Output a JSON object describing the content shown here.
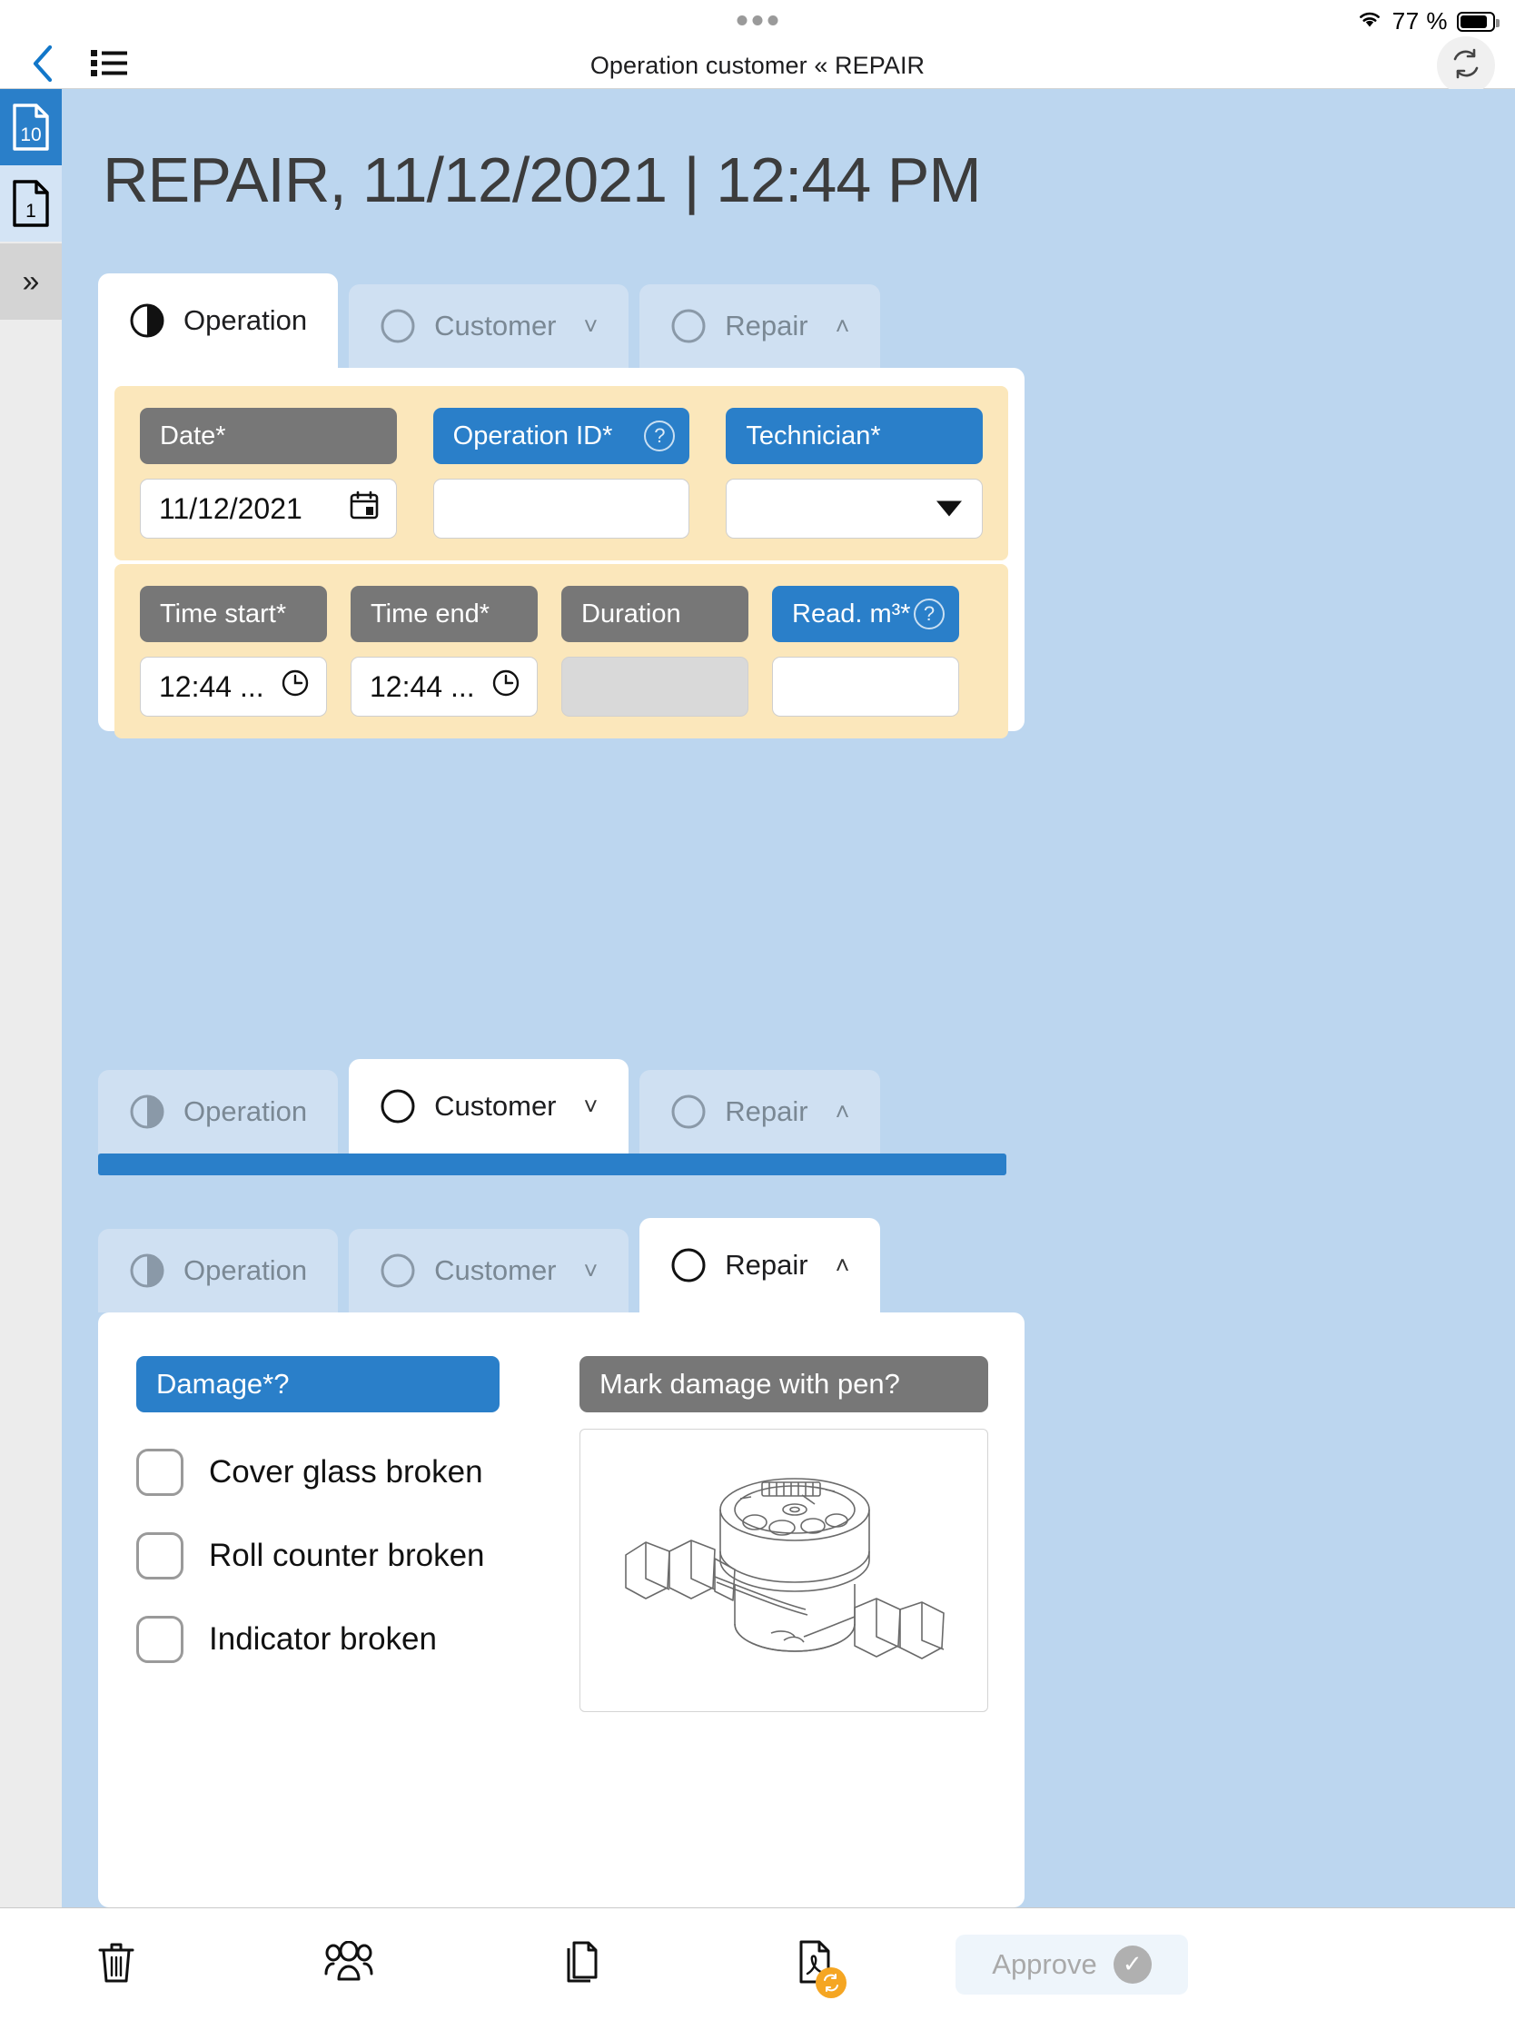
{
  "statusbar": {
    "battery_percent": "77 %",
    "wifi_icon": "wifi-icon",
    "battery_icon": "battery-icon"
  },
  "navbar": {
    "title": "Operation customer « REPAIR",
    "back_icon": "back-chevron-icon",
    "list_icon": "list-menu-icon",
    "refresh_icon": "sync-refresh-icon"
  },
  "sidebar": {
    "items": [
      {
        "name": "document-badge-10",
        "count": "10",
        "state": "active"
      },
      {
        "name": "document-badge-1",
        "count": "1",
        "state": "light"
      },
      {
        "name": "expand-sidebar",
        "glyph": "»",
        "state": "grey"
      }
    ]
  },
  "header": {
    "record_name": "REPAIR,",
    "record_datetime": "11/12/2021 | 12:44 PM"
  },
  "tabs_operation": [
    {
      "label": "Operation",
      "state": "active",
      "progress": "half",
      "chevron": ""
    },
    {
      "label": "Customer",
      "state": "inactive",
      "progress": "empty",
      "chevron": "˅"
    },
    {
      "label": "Repair",
      "state": "inactive",
      "progress": "empty",
      "chevron": "˄"
    }
  ],
  "tabs_customer": [
    {
      "label": "Operation",
      "state": "inactive",
      "progress": "half",
      "chevron": ""
    },
    {
      "label": "Customer",
      "state": "active",
      "progress": "empty",
      "chevron": "˅"
    },
    {
      "label": "Repair",
      "state": "inactive",
      "progress": "empty",
      "chevron": "˄"
    }
  ],
  "tabs_repair": [
    {
      "label": "Operation",
      "state": "inactive",
      "progress": "half",
      "chevron": ""
    },
    {
      "label": "Customer",
      "state": "inactive",
      "progress": "empty",
      "chevron": "˅"
    },
    {
      "label": "Repair",
      "state": "active",
      "progress": "empty",
      "chevron": "˄"
    }
  ],
  "operation_form": {
    "row1": [
      {
        "label": "Date*",
        "label_style": "grey",
        "help": false,
        "value": "11/12/2021",
        "placeholder": "",
        "icon": "calendar-icon",
        "kind": "date"
      },
      {
        "label": "Operation ID*",
        "label_style": "blue",
        "help": true,
        "value": "",
        "placeholder": "",
        "icon": "",
        "kind": "text"
      },
      {
        "label": "Technician*",
        "label_style": "blue",
        "help": false,
        "value": "",
        "placeholder": "",
        "icon": "dropdown-caret-icon",
        "kind": "select"
      }
    ],
    "row2": [
      {
        "label": "Time start*",
        "label_style": "grey",
        "help": false,
        "value": "12:44 ...",
        "placeholder": "",
        "icon": "clock-icon",
        "kind": "time"
      },
      {
        "label": "Time end*",
        "label_style": "grey",
        "help": false,
        "value": "12:44 ...",
        "placeholder": "",
        "icon": "clock-icon",
        "kind": "time"
      },
      {
        "label": "Duration",
        "label_style": "grey",
        "help": false,
        "value": "",
        "placeholder": "",
        "icon": "",
        "kind": "readonly"
      },
      {
        "label": "Read. m³*",
        "label_style": "blue",
        "help": true,
        "value": "",
        "placeholder": "",
        "icon": "",
        "kind": "text"
      }
    ],
    "help_glyph": "?"
  },
  "repair_form": {
    "damage_label": "Damage*",
    "damage_help": "?",
    "pen_label": "Mark damage with pen",
    "pen_help": "?",
    "checkboxes": [
      {
        "label": "Cover glass broken",
        "checked": false
      },
      {
        "label": "Roll counter broken",
        "checked": false
      },
      {
        "label": "Indicator broken",
        "checked": false
      }
    ],
    "image_alt": "water-meter-drawing"
  },
  "toolbar": {
    "items": [
      {
        "name": "delete-icon",
        "label": ""
      },
      {
        "name": "contacts-icon",
        "label": ""
      },
      {
        "name": "copy-icon",
        "label": ""
      },
      {
        "name": "pdf-sync-icon",
        "label": ""
      }
    ],
    "approve_label": "Approve",
    "approve_icon": "check-circle-icon"
  },
  "colors": {
    "accent_blue": "#2a7fc9",
    "content_bg": "#bcd6ef",
    "tab_inactive": "#cfe0f2",
    "label_grey": "#777777",
    "yellow_panel": "#fbe7bb",
    "pdf_badge": "#f5a623"
  }
}
